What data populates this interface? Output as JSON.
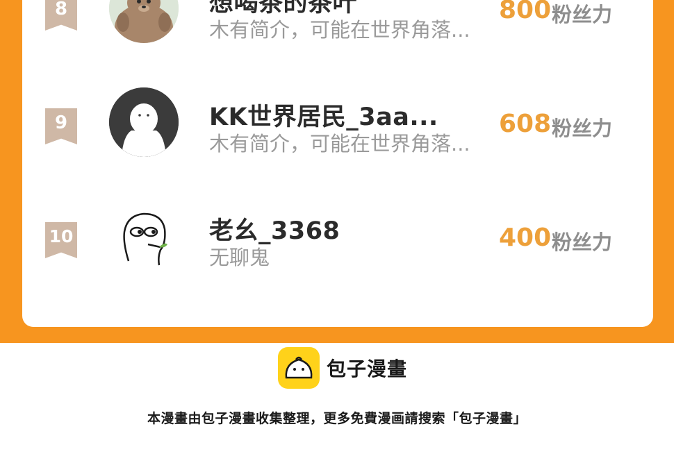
{
  "colors": {
    "accent": "#f7951f",
    "score": "#eda03a",
    "rank_badge": "#cfb8a6",
    "brand_yellow": "#ffd21a"
  },
  "ranking": [
    {
      "rank": "8",
      "name": "想喝茶的茶叶",
      "bio": "木有简介，可能在世界角落...",
      "score": "800",
      "unit": "粉丝力",
      "avatar": "bear-avatar"
    },
    {
      "rank": "9",
      "name": "KK世界居民_3aa...",
      "bio": "木有简介，可能在世界角落...",
      "score": "608",
      "unit": "粉丝力",
      "avatar": "ghost-avatar"
    },
    {
      "rank": "10",
      "name": "老幺_3368",
      "bio": "无聊鬼",
      "score": "400",
      "unit": "粉丝力",
      "avatar": "doodle-avatar"
    }
  ],
  "brand": {
    "name": "包子漫畫",
    "icon": "bun-logo-icon"
  },
  "footer": {
    "note": "本漫畫由包子漫畫收集整理，更多免費漫画請搜索「包子漫畫」"
  }
}
